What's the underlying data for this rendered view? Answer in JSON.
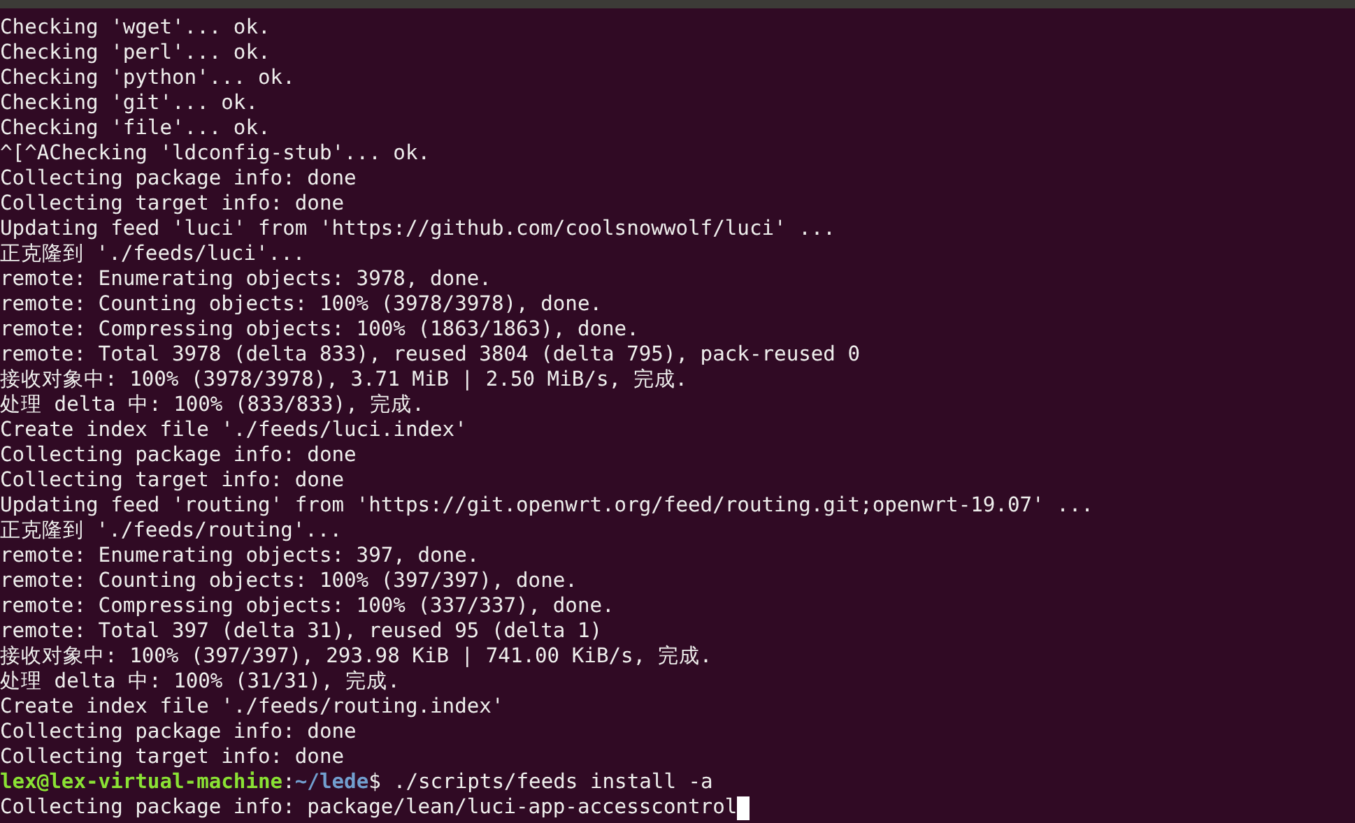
{
  "terminal": {
    "lines": [
      {
        "kind": "output",
        "text": "Checking 'wget'... ok."
      },
      {
        "kind": "output",
        "text": "Checking 'perl'... ok."
      },
      {
        "kind": "output",
        "text": "Checking 'python'... ok."
      },
      {
        "kind": "output",
        "text": "Checking 'git'... ok."
      },
      {
        "kind": "output",
        "text": "Checking 'file'... ok."
      },
      {
        "kind": "output",
        "text": "^[^AChecking 'ldconfig-stub'... ok."
      },
      {
        "kind": "output",
        "text": "Collecting package info: done"
      },
      {
        "kind": "output",
        "text": "Collecting target info: done"
      },
      {
        "kind": "output",
        "text": "Updating feed 'luci' from 'https://github.com/coolsnowwolf/luci' ..."
      },
      {
        "kind": "output",
        "text": "正克隆到 './feeds/luci'..."
      },
      {
        "kind": "output",
        "text": "remote: Enumerating objects: 3978, done."
      },
      {
        "kind": "output",
        "text": "remote: Counting objects: 100% (3978/3978), done."
      },
      {
        "kind": "output",
        "text": "remote: Compressing objects: 100% (1863/1863), done."
      },
      {
        "kind": "output",
        "text": "remote: Total 3978 (delta 833), reused 3804 (delta 795), pack-reused 0"
      },
      {
        "kind": "output",
        "text": "接收对象中: 100% (3978/3978), 3.71 MiB | 2.50 MiB/s, 完成."
      },
      {
        "kind": "output",
        "text": "处理 delta 中: 100% (833/833), 完成."
      },
      {
        "kind": "output",
        "text": "Create index file './feeds/luci.index'"
      },
      {
        "kind": "output",
        "text": "Collecting package info: done"
      },
      {
        "kind": "output",
        "text": "Collecting target info: done"
      },
      {
        "kind": "output",
        "text": "Updating feed 'routing' from 'https://git.openwrt.org/feed/routing.git;openwrt-19.07' ..."
      },
      {
        "kind": "output",
        "text": "正克隆到 './feeds/routing'..."
      },
      {
        "kind": "output",
        "text": "remote: Enumerating objects: 397, done."
      },
      {
        "kind": "output",
        "text": "remote: Counting objects: 100% (397/397), done."
      },
      {
        "kind": "output",
        "text": "remote: Compressing objects: 100% (337/337), done."
      },
      {
        "kind": "output",
        "text": "remote: Total 397 (delta 31), reused 95 (delta 1)"
      },
      {
        "kind": "output",
        "text": "接收对象中: 100% (397/397), 293.98 KiB | 741.00 KiB/s, 完成."
      },
      {
        "kind": "output",
        "text": "处理 delta 中: 100% (31/31), 完成."
      },
      {
        "kind": "output",
        "text": "Create index file './feeds/routing.index'"
      },
      {
        "kind": "output",
        "text": "Collecting package info: done"
      },
      {
        "kind": "output",
        "text": "Collecting target info: done"
      },
      {
        "kind": "prompt",
        "user": "lex@lex-virtual-machine",
        "separator": ":",
        "path": "~/lede",
        "symbol": "$",
        "command": "./scripts/feeds install -a"
      },
      {
        "kind": "output",
        "text": "Collecting package info: package/lean/luci-app-accesscontrol",
        "cursor": true
      }
    ]
  }
}
